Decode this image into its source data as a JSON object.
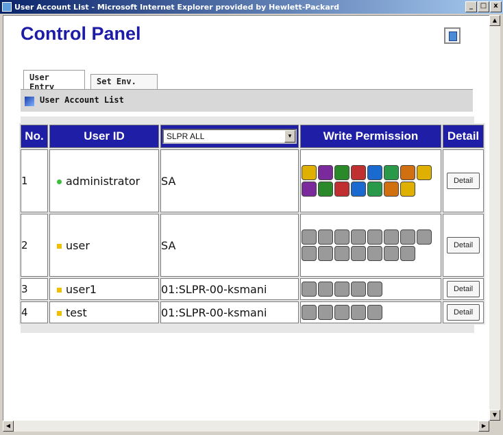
{
  "window": {
    "title": "User Account List - Microsoft Internet Explorer provided by Hewlett-Packard",
    "buttons": [
      "_",
      "□",
      "x"
    ]
  },
  "page": {
    "title": "Control Panel"
  },
  "tabs": [
    {
      "label": "User Entry",
      "active": true
    },
    {
      "label": "Set Env.",
      "active": false
    }
  ],
  "toolbar": {
    "label": "User Account List"
  },
  "table": {
    "headers": {
      "no": "No.",
      "user_id": "User ID",
      "write_permission": "Write Permission",
      "detail": "Detail"
    },
    "filter": {
      "selected": "SLPR ALL"
    },
    "rows": [
      {
        "no": "1",
        "user_id": "administrator",
        "bullet": "green",
        "auth": "SA",
        "permissions": 15,
        "permission_state": "enabled",
        "detail": "Detail"
      },
      {
        "no": "2",
        "user_id": "user",
        "bullet": "yellow",
        "auth": "SA",
        "permissions": 15,
        "permission_state": "disabled",
        "detail": "Detail"
      },
      {
        "no": "3",
        "user_id": "user1",
        "bullet": "yellow",
        "auth": "01:SLPR-00-ksmani",
        "permissions": 5,
        "permission_state": "disabled",
        "detail": "Detail"
      },
      {
        "no": "4",
        "user_id": "test",
        "bullet": "yellow",
        "auth": "01:SLPR-00-ksmani",
        "permissions": 5,
        "permission_state": "disabled",
        "detail": "Detail"
      }
    ]
  },
  "colors": {
    "header_bg": "#1e1ea6",
    "title_color": "#1c1ca8",
    "permission_enabled": [
      "#e0b000",
      "#7a2a9a",
      "#2a8a2a",
      "#c03030",
      "#1a6ad0",
      "#2a9a4a",
      "#d07010"
    ],
    "permission_disabled": "#9a9a9a"
  },
  "icons": {
    "window_icon": "ie-icon",
    "toolbar_icon": "list-icon",
    "panel_button_icon": "window-icon"
  }
}
